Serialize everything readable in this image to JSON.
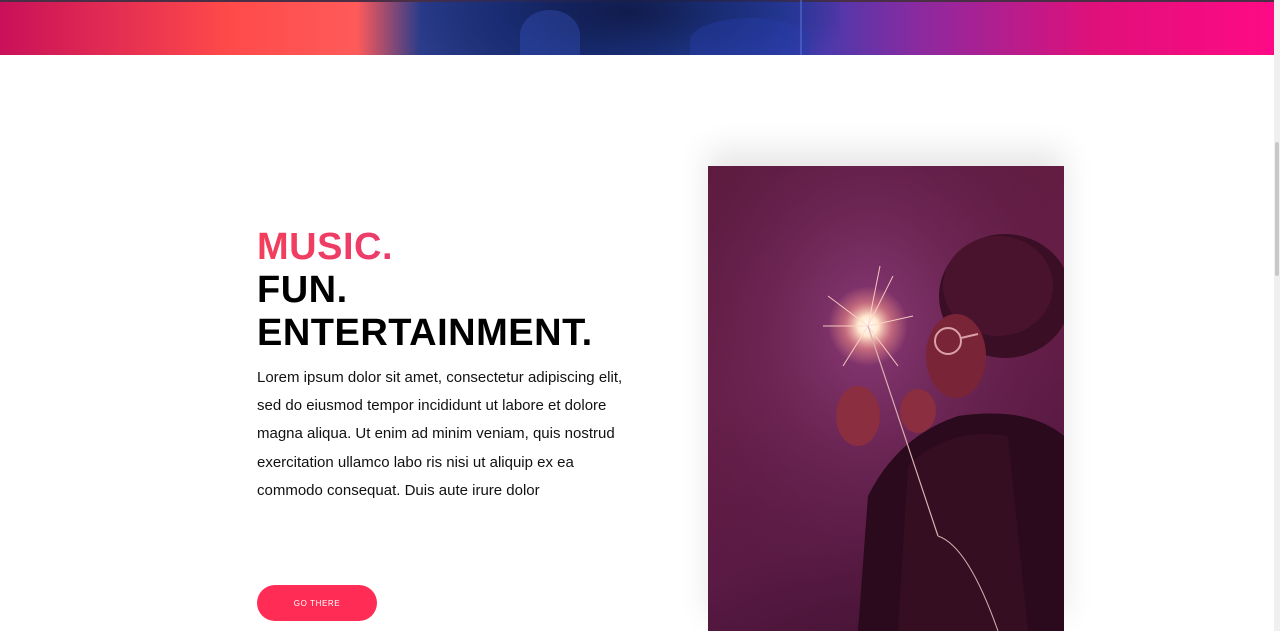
{
  "hero": {
    "image_name": "hero-banner-image"
  },
  "section": {
    "headline_accent": "MUSIC.",
    "headline_line2": "FUN.",
    "headline_line3": "ENTERTAINMENT.",
    "body": "Lorem ipsum dolor sit amet, consectetur adipiscing elit, sed do eiusmod tempor incididunt ut labore et dolore magna aliqua. Ut enim ad minim veniam, quis nostrud exercitation ullamco labo ris nisi ut aliquip ex ea\ncommodo consequat. Duis aute irure dolor",
    "cta_label": "GO THERE"
  },
  "photo": {
    "image_name": "person-with-sparkler-photo"
  },
  "colors": {
    "accent": "#ff2d55",
    "accent_gradient_start": "#f23e5a",
    "accent_gradient_end": "#e23a8a",
    "headline": "#000000",
    "photo_tint": "#5e1b3e"
  }
}
